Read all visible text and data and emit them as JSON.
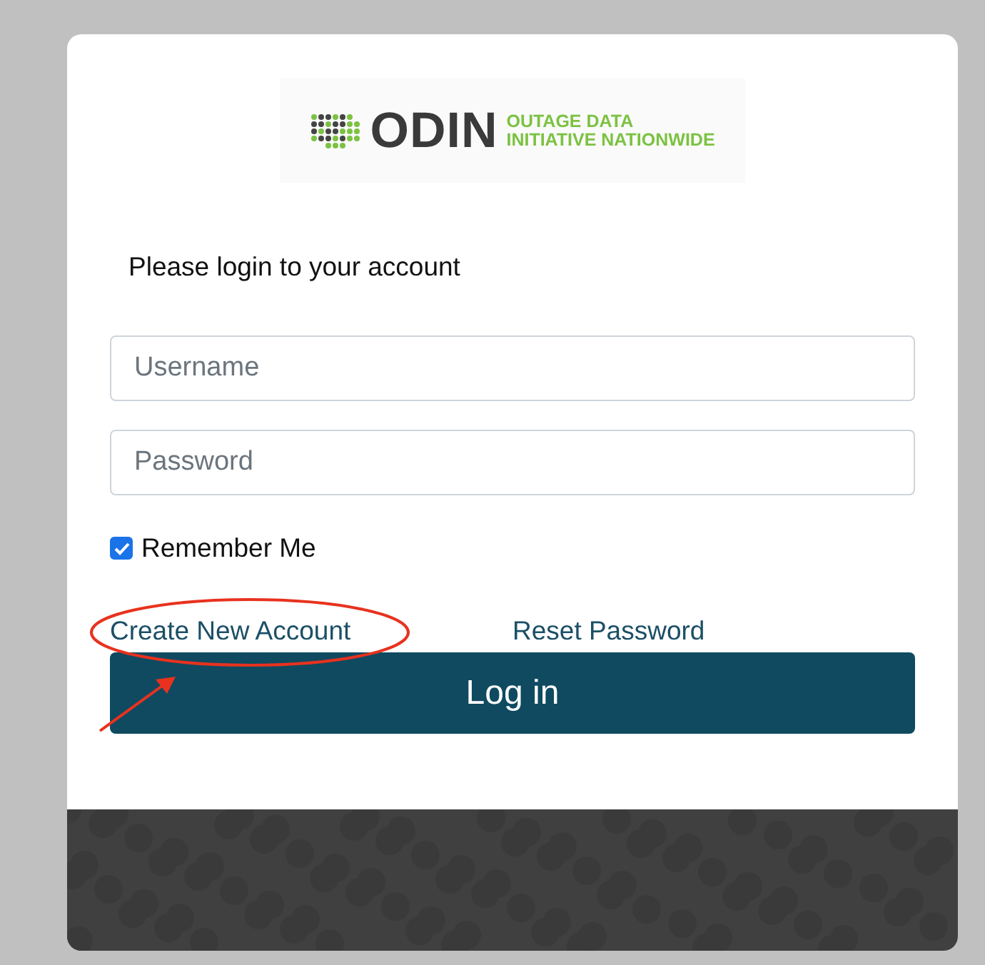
{
  "logo": {
    "name": "ODIN",
    "tagline_lines": [
      "OUTAGE DATA",
      "INITIATIVE NATIONWIDE"
    ]
  },
  "prompt": "Please login to your account",
  "fields": [
    {
      "placeholder": "Username"
    },
    {
      "placeholder": "Password"
    }
  ],
  "remember": {
    "label": "Remember Me",
    "checked": true
  },
  "links": [
    {
      "label": "Create New Account",
      "annotated": true
    },
    {
      "label": "Reset Password",
      "annotated": false
    }
  ],
  "login_button": "Log in"
}
